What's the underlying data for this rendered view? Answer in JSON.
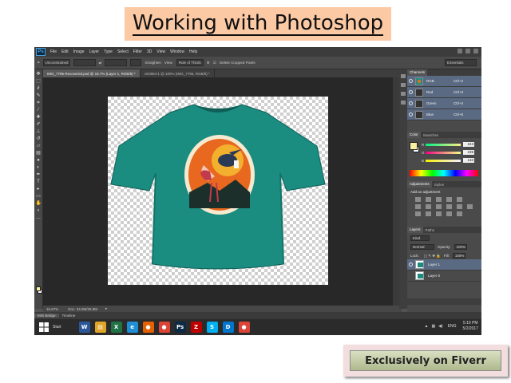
{
  "title": "Working with Photoshop",
  "photoshop": {
    "logo": "Ps",
    "menu": [
      "File",
      "Edit",
      "Image",
      "Layer",
      "Type",
      "Select",
      "Filter",
      "3D",
      "View",
      "Window",
      "Help"
    ],
    "options": {
      "ratio": "Unconstrained",
      "straighten": "Straighten",
      "view_label": "View:",
      "view_value": "Rule of Thirds",
      "delete_cropped": "Delete Cropped Pixels",
      "workspace": "Essentials"
    },
    "tabs": [
      {
        "label": "IMG_7795 Recovered.psd @ 16.7% (Layer 1, RGB/8) *",
        "active": true
      },
      {
        "label": "Untitled-1 @ 100% (IMG_7795, RGB/8) *",
        "active": false
      }
    ],
    "status": {
      "zoom": "16.67%",
      "doc": "Doc: 34.9M/26.9M"
    },
    "bottom_tabs": [
      "Mini Bridge",
      "Timeline"
    ],
    "panels": {
      "channels_tab": "Channels",
      "channels": [
        {
          "name": "RGB",
          "key": "Ctrl+2"
        },
        {
          "name": "Red",
          "key": "Ctrl+3"
        },
        {
          "name": "Green",
          "key": "Ctrl+4"
        },
        {
          "name": "Blue",
          "key": "Ctrl+5"
        }
      ],
      "color_tabs": [
        "Color",
        "Swatches"
      ],
      "color_values": {
        "r": "243",
        "g": "239",
        "b": "133"
      },
      "adjust_tabs": [
        "Adjustments",
        "Styles"
      ],
      "adjust_label": "Add an adjustment",
      "layer_tabs": [
        "Layers",
        "Paths"
      ],
      "layer_kind": "Kind",
      "blend_mode": "Normal",
      "opacity_label": "Opacity:",
      "opacity_value": "100%",
      "lock_label": "Lock:",
      "fill_label": "Fill:",
      "fill_value": "100%",
      "layers": [
        {
          "name": "Layer 1",
          "selected": true
        },
        {
          "name": "Layer 0",
          "selected": false
        }
      ]
    }
  },
  "taskbar": {
    "start_label": "Start",
    "lang": "ENG",
    "time": "5:19 PM",
    "date": "5/2/2017",
    "apps": [
      {
        "name": "word",
        "glyph": "W",
        "color": "#2b579a"
      },
      {
        "name": "file-explorer",
        "glyph": "▤",
        "color": "#e0a526"
      },
      {
        "name": "excel",
        "glyph": "X",
        "color": "#217346"
      },
      {
        "name": "internet-explorer",
        "glyph": "e",
        "color": "#1e8fd6"
      },
      {
        "name": "firefox",
        "glyph": "●",
        "color": "#e66000"
      },
      {
        "name": "chrome",
        "glyph": "●",
        "color": "#db4437"
      },
      {
        "name": "photoshop",
        "glyph": "Ps",
        "color": "#0d2a44"
      },
      {
        "name": "filezilla",
        "glyph": "Z",
        "color": "#bf0000"
      },
      {
        "name": "skype",
        "glyph": "S",
        "color": "#00aff0"
      },
      {
        "name": "dell",
        "glyph": "D",
        "color": "#0076ce"
      },
      {
        "name": "chrome-2",
        "glyph": "●",
        "color": "#db4437"
      }
    ]
  },
  "badge": "Exclusively on Fiverr"
}
